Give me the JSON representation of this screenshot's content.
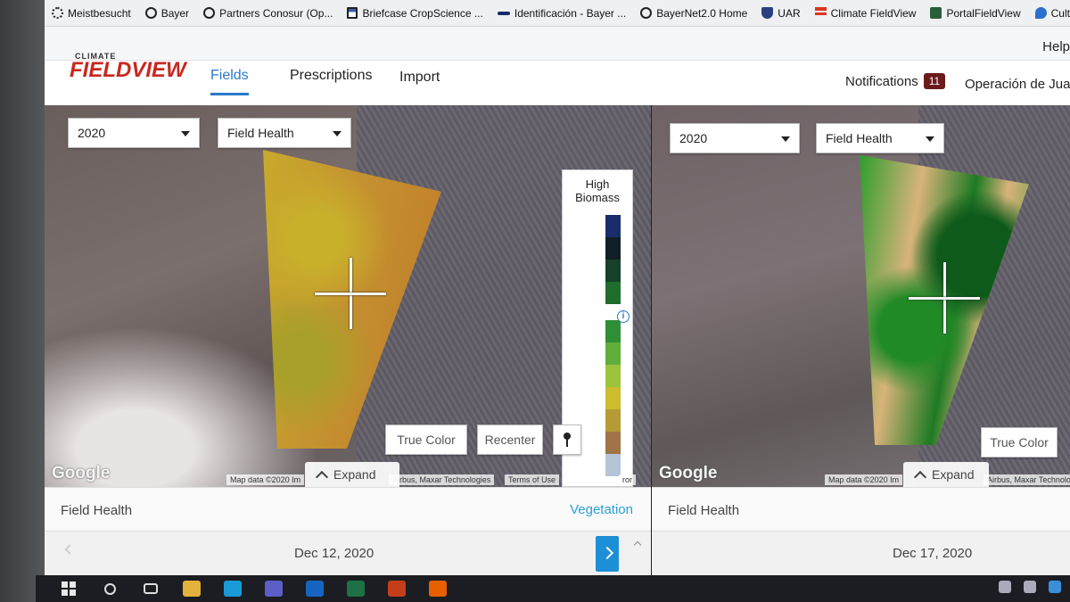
{
  "bookmarks": [
    {
      "label": "Meistbesucht",
      "icon": "gear-icon"
    },
    {
      "label": "Bayer",
      "icon": "globe-icon"
    },
    {
      "label": "Partners Conosur (Op...",
      "icon": "globe-icon"
    },
    {
      "label": "Briefcase CropScience ...",
      "icon": "document-icon"
    },
    {
      "label": "Identificación - Bayer ...",
      "icon": "arrow-icon"
    },
    {
      "label": "BayerNet2.0 Home",
      "icon": "globe-icon"
    },
    {
      "label": "UAR",
      "icon": "shield-icon"
    },
    {
      "label": "Climate FieldView",
      "icon": "fieldview-icon"
    },
    {
      "label": "PortalFieldView",
      "icon": "portal-icon"
    },
    {
      "label": "Cultivio",
      "icon": "cultivio-icon"
    }
  ],
  "header": {
    "help": "Help",
    "logo_small": "CLIMATE",
    "logo_big": "FIELDVIEW",
    "tabs": [
      {
        "label": "Fields",
        "active": true
      },
      {
        "label": "Prescriptions",
        "active": false
      },
      {
        "label": "Import",
        "active": false
      }
    ],
    "notifications_label": "Notifications",
    "notifications_count": "11",
    "operation": "Operación de Jua"
  },
  "left_panel": {
    "year": "2020",
    "layer": "Field Health",
    "legend_title": "High Biomass",
    "legend_colors": [
      "#1a2d6b",
      "#0f1f25",
      "#16402a",
      "#1f6d2c",
      "#ffffff",
      "#2e8f36",
      "#5fae3a",
      "#9bc43d",
      "#cbbd2d",
      "#b59b36",
      "#a07448",
      "#b5c4d6"
    ],
    "btn_true_color": "True Color",
    "btn_recenter": "Recenter",
    "expand": "Expand",
    "attribution_1": "Map data ©2020 Im",
    "attribution_2": "Airbus, Maxar Technologies",
    "attribution_3": "Terms of Use",
    "attribution_4": "ror",
    "google": "Google",
    "info_label": "Field Health",
    "vegetation": "Vegetation",
    "date": "Dec 12, 2020"
  },
  "right_panel": {
    "year": "2020",
    "layer": "Field Health",
    "btn_true_color": "True Color",
    "expand": "Expand",
    "attribution_1": "Map data ©2020 Im",
    "attribution_2": "Airbus, Maxar Technolo",
    "google": "Google",
    "info_label": "Field Health",
    "date": "Dec 17, 2020"
  },
  "colors": {
    "accent": "#2b79c7",
    "brand_red": "#c8281e",
    "badge": "#6b1b1b",
    "vegetation_link": "#2b9fd8",
    "handle": "#1d8fd6"
  },
  "taskbar": {
    "apps": [
      {
        "icon": "file-explorer-icon",
        "color": "#e3b23c"
      },
      {
        "icon": "skype-icon",
        "color": "#1a9bd7"
      },
      {
        "icon": "teams-icon",
        "color": "#5b5fc7"
      },
      {
        "icon": "outlook-icon",
        "color": "#1565c0"
      },
      {
        "icon": "excel-icon",
        "color": "#1e7145"
      },
      {
        "icon": "powerpoint-icon",
        "color": "#c43e1c"
      },
      {
        "icon": "firefox-icon",
        "color": "#e66000"
      }
    ]
  }
}
